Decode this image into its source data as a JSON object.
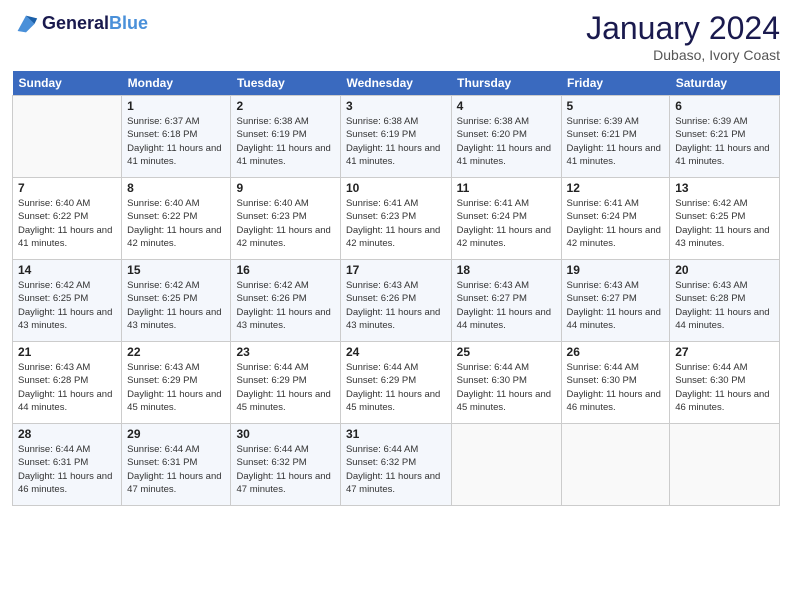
{
  "header": {
    "logo_line1": "General",
    "logo_line2": "Blue",
    "month_title": "January 2024",
    "location": "Dubaso, Ivory Coast"
  },
  "days_of_week": [
    "Sunday",
    "Monday",
    "Tuesday",
    "Wednesday",
    "Thursday",
    "Friday",
    "Saturday"
  ],
  "weeks": [
    [
      {
        "day": "",
        "sunrise": "",
        "sunset": "",
        "daylight": ""
      },
      {
        "day": "1",
        "sunrise": "Sunrise: 6:37 AM",
        "sunset": "Sunset: 6:18 PM",
        "daylight": "Daylight: 11 hours and 41 minutes."
      },
      {
        "day": "2",
        "sunrise": "Sunrise: 6:38 AM",
        "sunset": "Sunset: 6:19 PM",
        "daylight": "Daylight: 11 hours and 41 minutes."
      },
      {
        "day": "3",
        "sunrise": "Sunrise: 6:38 AM",
        "sunset": "Sunset: 6:19 PM",
        "daylight": "Daylight: 11 hours and 41 minutes."
      },
      {
        "day": "4",
        "sunrise": "Sunrise: 6:38 AM",
        "sunset": "Sunset: 6:20 PM",
        "daylight": "Daylight: 11 hours and 41 minutes."
      },
      {
        "day": "5",
        "sunrise": "Sunrise: 6:39 AM",
        "sunset": "Sunset: 6:21 PM",
        "daylight": "Daylight: 11 hours and 41 minutes."
      },
      {
        "day": "6",
        "sunrise": "Sunrise: 6:39 AM",
        "sunset": "Sunset: 6:21 PM",
        "daylight": "Daylight: 11 hours and 41 minutes."
      }
    ],
    [
      {
        "day": "7",
        "sunrise": "Sunrise: 6:40 AM",
        "sunset": "Sunset: 6:22 PM",
        "daylight": "Daylight: 11 hours and 41 minutes."
      },
      {
        "day": "8",
        "sunrise": "Sunrise: 6:40 AM",
        "sunset": "Sunset: 6:22 PM",
        "daylight": "Daylight: 11 hours and 42 minutes."
      },
      {
        "day": "9",
        "sunrise": "Sunrise: 6:40 AM",
        "sunset": "Sunset: 6:23 PM",
        "daylight": "Daylight: 11 hours and 42 minutes."
      },
      {
        "day": "10",
        "sunrise": "Sunrise: 6:41 AM",
        "sunset": "Sunset: 6:23 PM",
        "daylight": "Daylight: 11 hours and 42 minutes."
      },
      {
        "day": "11",
        "sunrise": "Sunrise: 6:41 AM",
        "sunset": "Sunset: 6:24 PM",
        "daylight": "Daylight: 11 hours and 42 minutes."
      },
      {
        "day": "12",
        "sunrise": "Sunrise: 6:41 AM",
        "sunset": "Sunset: 6:24 PM",
        "daylight": "Daylight: 11 hours and 42 minutes."
      },
      {
        "day": "13",
        "sunrise": "Sunrise: 6:42 AM",
        "sunset": "Sunset: 6:25 PM",
        "daylight": "Daylight: 11 hours and 43 minutes."
      }
    ],
    [
      {
        "day": "14",
        "sunrise": "Sunrise: 6:42 AM",
        "sunset": "Sunset: 6:25 PM",
        "daylight": "Daylight: 11 hours and 43 minutes."
      },
      {
        "day": "15",
        "sunrise": "Sunrise: 6:42 AM",
        "sunset": "Sunset: 6:25 PM",
        "daylight": "Daylight: 11 hours and 43 minutes."
      },
      {
        "day": "16",
        "sunrise": "Sunrise: 6:42 AM",
        "sunset": "Sunset: 6:26 PM",
        "daylight": "Daylight: 11 hours and 43 minutes."
      },
      {
        "day": "17",
        "sunrise": "Sunrise: 6:43 AM",
        "sunset": "Sunset: 6:26 PM",
        "daylight": "Daylight: 11 hours and 43 minutes."
      },
      {
        "day": "18",
        "sunrise": "Sunrise: 6:43 AM",
        "sunset": "Sunset: 6:27 PM",
        "daylight": "Daylight: 11 hours and 44 minutes."
      },
      {
        "day": "19",
        "sunrise": "Sunrise: 6:43 AM",
        "sunset": "Sunset: 6:27 PM",
        "daylight": "Daylight: 11 hours and 44 minutes."
      },
      {
        "day": "20",
        "sunrise": "Sunrise: 6:43 AM",
        "sunset": "Sunset: 6:28 PM",
        "daylight": "Daylight: 11 hours and 44 minutes."
      }
    ],
    [
      {
        "day": "21",
        "sunrise": "Sunrise: 6:43 AM",
        "sunset": "Sunset: 6:28 PM",
        "daylight": "Daylight: 11 hours and 44 minutes."
      },
      {
        "day": "22",
        "sunrise": "Sunrise: 6:43 AM",
        "sunset": "Sunset: 6:29 PM",
        "daylight": "Daylight: 11 hours and 45 minutes."
      },
      {
        "day": "23",
        "sunrise": "Sunrise: 6:44 AM",
        "sunset": "Sunset: 6:29 PM",
        "daylight": "Daylight: 11 hours and 45 minutes."
      },
      {
        "day": "24",
        "sunrise": "Sunrise: 6:44 AM",
        "sunset": "Sunset: 6:29 PM",
        "daylight": "Daylight: 11 hours and 45 minutes."
      },
      {
        "day": "25",
        "sunrise": "Sunrise: 6:44 AM",
        "sunset": "Sunset: 6:30 PM",
        "daylight": "Daylight: 11 hours and 45 minutes."
      },
      {
        "day": "26",
        "sunrise": "Sunrise: 6:44 AM",
        "sunset": "Sunset: 6:30 PM",
        "daylight": "Daylight: 11 hours and 46 minutes."
      },
      {
        "day": "27",
        "sunrise": "Sunrise: 6:44 AM",
        "sunset": "Sunset: 6:30 PM",
        "daylight": "Daylight: 11 hours and 46 minutes."
      }
    ],
    [
      {
        "day": "28",
        "sunrise": "Sunrise: 6:44 AM",
        "sunset": "Sunset: 6:31 PM",
        "daylight": "Daylight: 11 hours and 46 minutes."
      },
      {
        "day": "29",
        "sunrise": "Sunrise: 6:44 AM",
        "sunset": "Sunset: 6:31 PM",
        "daylight": "Daylight: 11 hours and 47 minutes."
      },
      {
        "day": "30",
        "sunrise": "Sunrise: 6:44 AM",
        "sunset": "Sunset: 6:32 PM",
        "daylight": "Daylight: 11 hours and 47 minutes."
      },
      {
        "day": "31",
        "sunrise": "Sunrise: 6:44 AM",
        "sunset": "Sunset: 6:32 PM",
        "daylight": "Daylight: 11 hours and 47 minutes."
      },
      {
        "day": "",
        "sunrise": "",
        "sunset": "",
        "daylight": ""
      },
      {
        "day": "",
        "sunrise": "",
        "sunset": "",
        "daylight": ""
      },
      {
        "day": "",
        "sunrise": "",
        "sunset": "",
        "daylight": ""
      }
    ]
  ]
}
